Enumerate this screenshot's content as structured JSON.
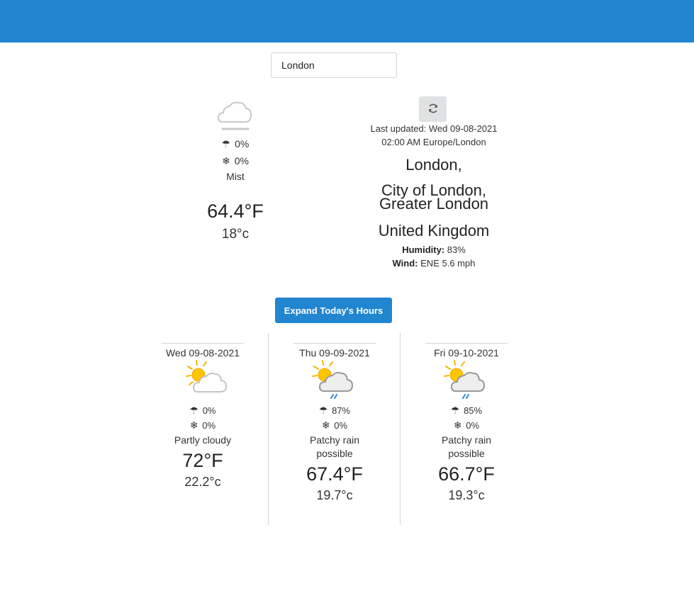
{
  "search": {
    "value": "London"
  },
  "current": {
    "icon": "mist-cloud-icon",
    "precip_rain": "0%",
    "precip_snow": "0%",
    "condition": "Mist",
    "temp_f": "64.4°F",
    "temp_c": "18°c",
    "last_updated_line1": "Last updated: Wed 09-08-2021",
    "last_updated_line2": "02:00 AM Europe/London",
    "location_city": "London,",
    "location_region_1": "City of London,",
    "location_region_2": "Greater London",
    "location_country": "United Kingdom",
    "humidity_label": "Humidity:",
    "humidity_value": "83%",
    "wind_label": "Wind:",
    "wind_value": "ENE 5.6 mph"
  },
  "expand_button": {
    "label": "Expand Today's Hours"
  },
  "forecast": [
    {
      "date": "Wed 09-08-2021",
      "icon": "partly-cloudy-icon",
      "precip_rain": "0%",
      "precip_snow": "0%",
      "condition": "Partly cloudy",
      "temp_f": "72°F",
      "temp_c": "22.2°c"
    },
    {
      "date": "Thu 09-09-2021",
      "icon": "patchy-rain-icon",
      "precip_rain": "87%",
      "precip_snow": "0%",
      "condition": "Patchy rain possible",
      "temp_f": "67.4°F",
      "temp_c": "19.7°c"
    },
    {
      "date": "Fri 09-10-2021",
      "icon": "patchy-rain-icon",
      "precip_rain": "85%",
      "precip_snow": "0%",
      "condition": "Patchy rain possible",
      "temp_f": "66.7°F",
      "temp_c": "19.3°c"
    }
  ],
  "colors": {
    "header": "#2285d0",
    "button": "#2185d0",
    "refresh_bg": "#e0e1e2"
  }
}
